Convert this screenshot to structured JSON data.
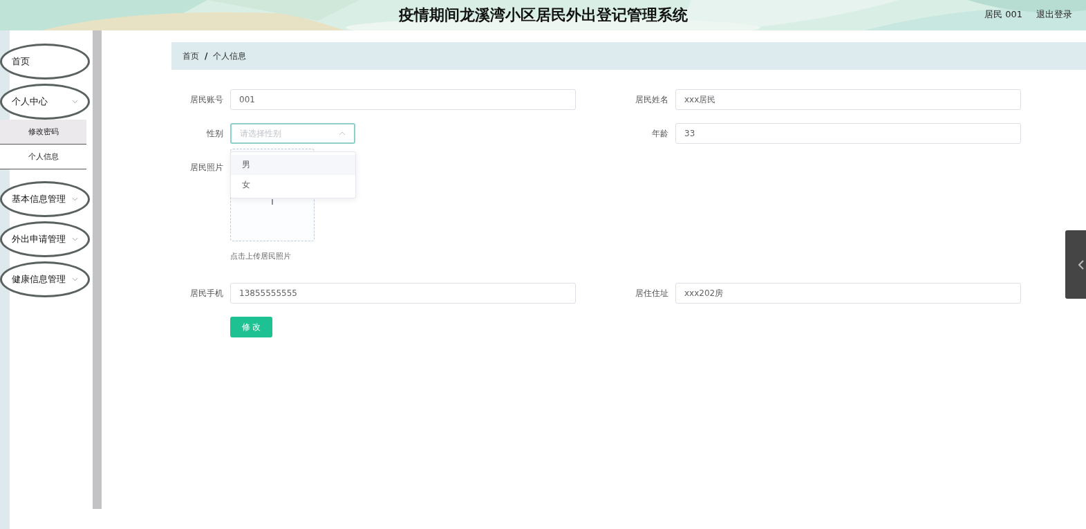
{
  "header": {
    "title": "疫情期间龙溪湾小区居民外出登记管理系统",
    "user": "居民 001",
    "logout": "退出登录"
  },
  "sidebar": {
    "items": [
      {
        "label": "首页",
        "kind": "link"
      },
      {
        "label": "个人中心",
        "kind": "menu",
        "expanded": true,
        "children": [
          {
            "label": "修改密码",
            "selected": true
          },
          {
            "label": "个人信息",
            "selected": false
          }
        ]
      },
      {
        "label": "基本信息管理",
        "kind": "menu"
      },
      {
        "label": "外出申请管理",
        "kind": "menu"
      },
      {
        "label": "健康信息管理",
        "kind": "menu"
      }
    ]
  },
  "breadcrumb": {
    "separator": "/",
    "items": [
      "首页",
      "个人信息"
    ]
  },
  "form": {
    "rows": [
      [
        {
          "label": "居民账号",
          "kind": "input",
          "value": "001"
        },
        {
          "label": "居民姓名",
          "kind": "input",
          "value": "xxx居民"
        }
      ],
      [
        {
          "label": "性别",
          "kind": "select",
          "placeholder": "请选择性别",
          "open": true,
          "options": [
            {
              "label": "男",
              "highlighted": true
            },
            {
              "label": "女",
              "highlighted": false
            }
          ]
        },
        {
          "label": "年龄",
          "kind": "input",
          "value": "33"
        }
      ],
      [
        {
          "label": "居民照片",
          "kind": "upload",
          "hint": "点击上传居民照片"
        }
      ],
      [
        {
          "label": "居民手机",
          "kind": "input",
          "value": "13855555555"
        },
        {
          "label": "居住住址",
          "kind": "input",
          "value": "xxx202房"
        }
      ]
    ],
    "submit": "修 改"
  }
}
